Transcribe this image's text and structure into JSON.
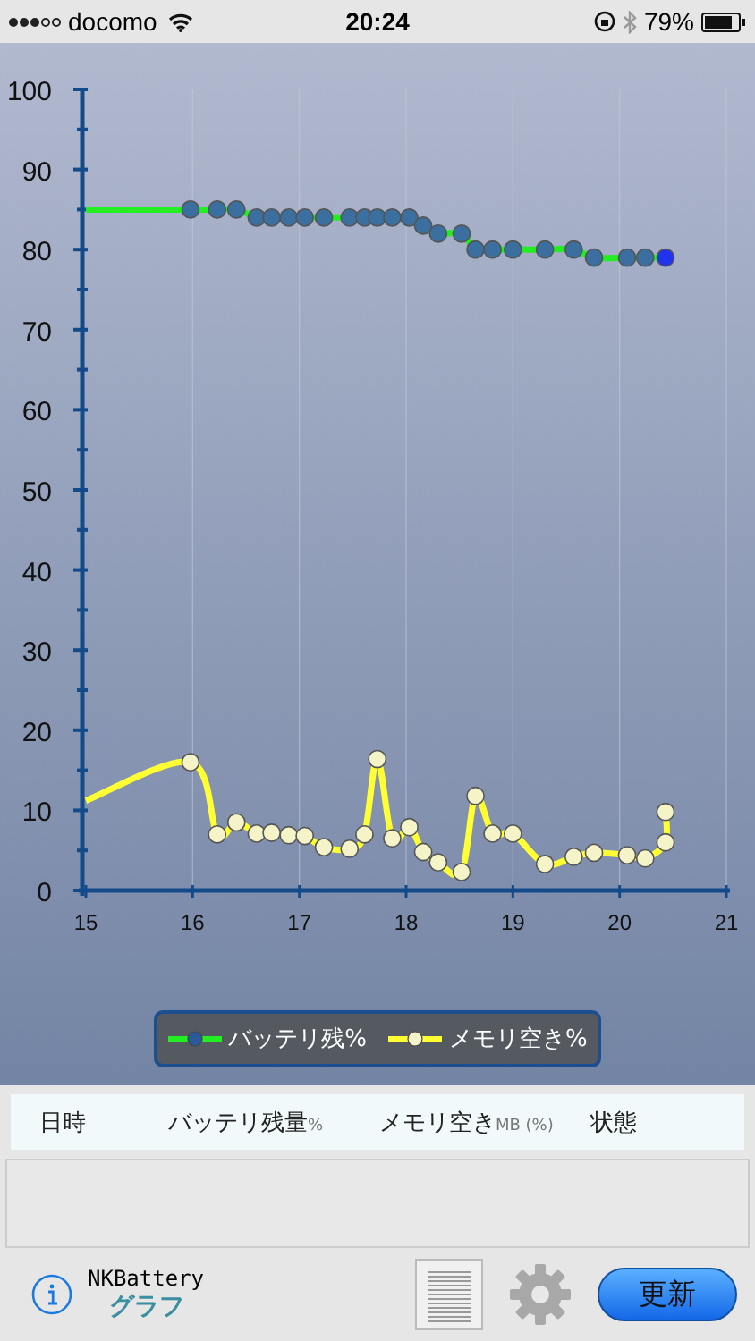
{
  "status_bar": {
    "carrier": "docomo",
    "time": "20:24",
    "battery": "79%"
  },
  "chart": {
    "chart_data": {
      "type": "line",
      "x": [
        15,
        15.98,
        16.23,
        16.41,
        16.6,
        16.74,
        16.9,
        17.05,
        17.23,
        17.47,
        17.61,
        17.73,
        17.87,
        18.03,
        18.16,
        18.3,
        18.52,
        18.65,
        18.81,
        19.0,
        19.3,
        19.57,
        19.76,
        20.07,
        20.24,
        20.43,
        20.43
      ],
      "grid": true,
      "xlim": [
        15,
        21
      ],
      "ylim": [
        0,
        100
      ],
      "xticks": [
        15,
        16,
        17,
        18,
        19,
        20,
        21
      ],
      "yticks": [
        0,
        10,
        20,
        30,
        40,
        50,
        60,
        70,
        80,
        90,
        100
      ],
      "series": [
        {
          "name": "バッテリ残%",
          "color": "#22ee22",
          "marker": "circle",
          "values": [
            85,
            85,
            85,
            85,
            84,
            84,
            84,
            84,
            84,
            84,
            84,
            84,
            84,
            84,
            83,
            82,
            82,
            80,
            80,
            80,
            80,
            80,
            79,
            79,
            79,
            79,
            null
          ]
        },
        {
          "name": "メモリ空き%",
          "color": "#ffff33",
          "marker": "circle",
          "values": [
            11.2,
            16,
            7,
            8.5,
            7.1,
            7.2,
            6.9,
            6.8,
            5.4,
            5.2,
            7,
            16.4,
            6.5,
            7.9,
            4.8,
            3.5,
            2.3,
            11.8,
            7.1,
            7.1,
            3.3,
            4.2,
            4.7,
            4.4,
            4,
            6,
            9.8
          ]
        }
      ]
    }
  },
  "table": {
    "columns": [
      {
        "label": "日時"
      },
      {
        "label": "バッテリ残量",
        "unit": "%"
      },
      {
        "label": "メモリ空き",
        "unit": "MB (%)"
      },
      {
        "label": "状態"
      }
    ]
  },
  "footer": {
    "app_name": "NKBattery",
    "mode": "グラフ",
    "update_button": "更新"
  }
}
